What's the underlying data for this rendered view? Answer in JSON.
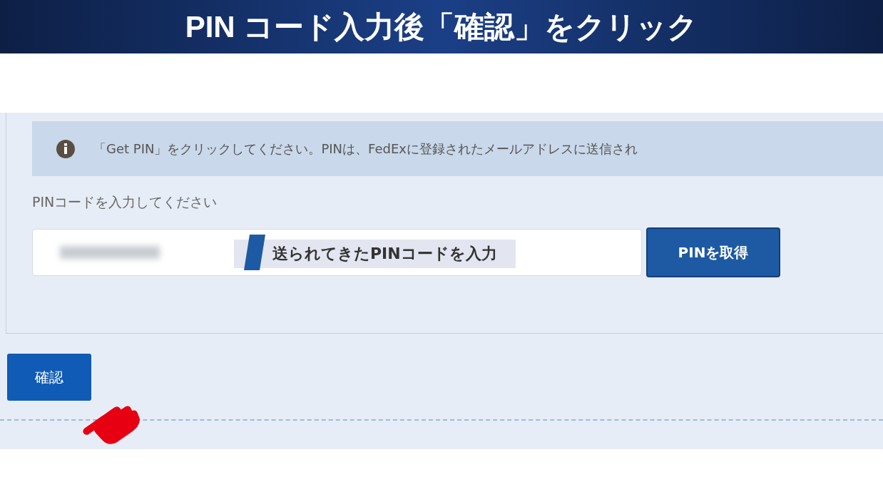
{
  "banner": {
    "title": "PIN コード入力後「確認」をクリック"
  },
  "alert": {
    "text": "「Get PIN」をクリックしてください。PINは、FedExに登録されたメールアドレスに送信され"
  },
  "pin_field": {
    "label": "PINコードを入力してください",
    "callout": "送られてきたPINコードを入力"
  },
  "get_pin_button": "PINを取得",
  "confirm_button": "確認"
}
